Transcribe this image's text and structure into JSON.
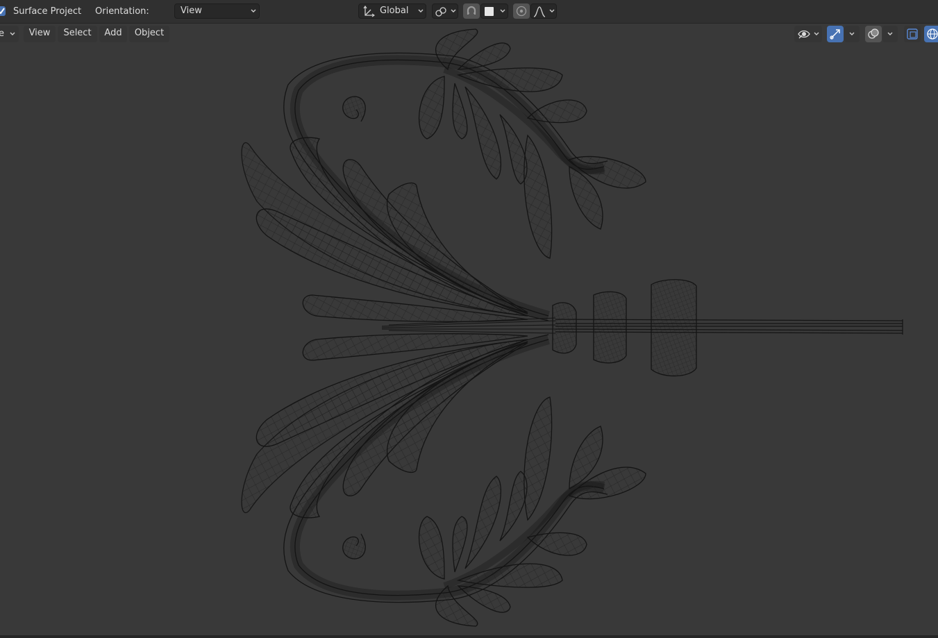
{
  "header": {
    "surface_project": {
      "label": "Surface Project",
      "checked": true
    },
    "orientation_label": "Orientation:",
    "orientation_value": "View",
    "transform_orientation": "Global"
  },
  "menu": {
    "items": [
      "View",
      "Select",
      "Add",
      "Object"
    ]
  },
  "icons": {
    "surface_project_checkbox": "checkbox-checked-icon",
    "transform_orientation": "axes-icon",
    "pivot": "link-pivot-icon",
    "snap": "magnet-icon",
    "snap_target": "square-snap-icon",
    "proportional": "proportional-edit-icon",
    "falloff": "falloff-curve-icon",
    "visibility": "eye-icon",
    "gizmo": "gizmo-icon",
    "overlays": "overlays-icon",
    "xray": "xray-icon",
    "shading_wireframe": "wireframe-sphere-icon"
  },
  "colors": {
    "accent": "#4772b3",
    "header_bg": "#303030",
    "viewport_bg": "#393939",
    "wire": "#141414"
  },
  "viewport": {
    "object": "ornamental acanthus leaf wireframe mesh"
  }
}
